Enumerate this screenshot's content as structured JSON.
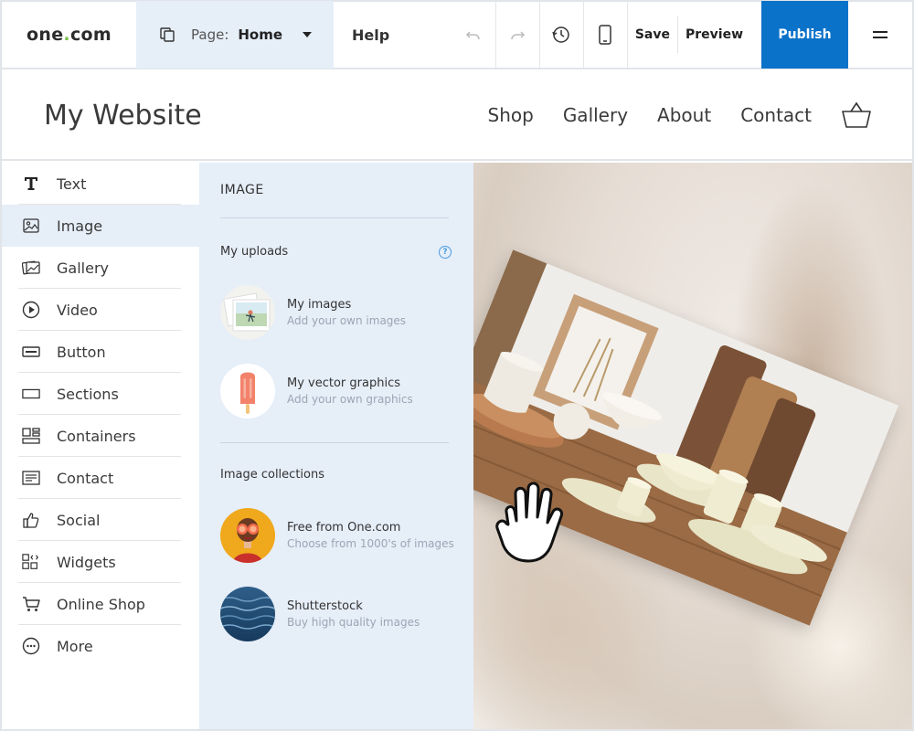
{
  "toolbar": {
    "logo_text": "one",
    "logo_dot": ".",
    "logo_suffix": "com",
    "page_label": "Page:",
    "page_value": "Home",
    "help_label": "Help",
    "save_label": "Save",
    "preview_label": "Preview",
    "publish_label": "Publish",
    "publish_color": "#0b72c9"
  },
  "site": {
    "title": "My Website",
    "nav": [
      "Shop",
      "Gallery",
      "About",
      "Contact"
    ]
  },
  "sidebar": {
    "items": [
      {
        "label": "Text",
        "icon": "text-icon"
      },
      {
        "label": "Image",
        "icon": "image-icon",
        "active": true
      },
      {
        "label": "Gallery",
        "icon": "gallery-icon"
      },
      {
        "label": "Video",
        "icon": "play-circle-icon"
      },
      {
        "label": "Button",
        "icon": "button-icon"
      },
      {
        "label": "Sections",
        "icon": "sections-icon"
      },
      {
        "label": "Containers",
        "icon": "containers-icon"
      },
      {
        "label": "Contact",
        "icon": "form-icon"
      },
      {
        "label": "Social",
        "icon": "thumbs-up-icon"
      },
      {
        "label": "Widgets",
        "icon": "widgets-icon"
      },
      {
        "label": "Online Shop",
        "icon": "cart-icon"
      },
      {
        "label": "More",
        "icon": "more-icon"
      }
    ]
  },
  "panel": {
    "title": "IMAGE",
    "uploads_label": "My uploads",
    "help": "?",
    "my_images_title": "My images",
    "my_images_sub": "Add your own images",
    "vector_title": "My vector graphics",
    "vector_sub": "Add your own graphics",
    "collections_label": "Image collections",
    "free_title": "Free from One.com",
    "free_sub": "Choose from 1000's of images",
    "shutter_title": "Shutterstock",
    "shutter_sub": "Buy high quality images"
  },
  "colors": {
    "accent": "#0b72c9",
    "panel_bg": "#e6eef8",
    "logo_dot": "#7cc14a"
  }
}
